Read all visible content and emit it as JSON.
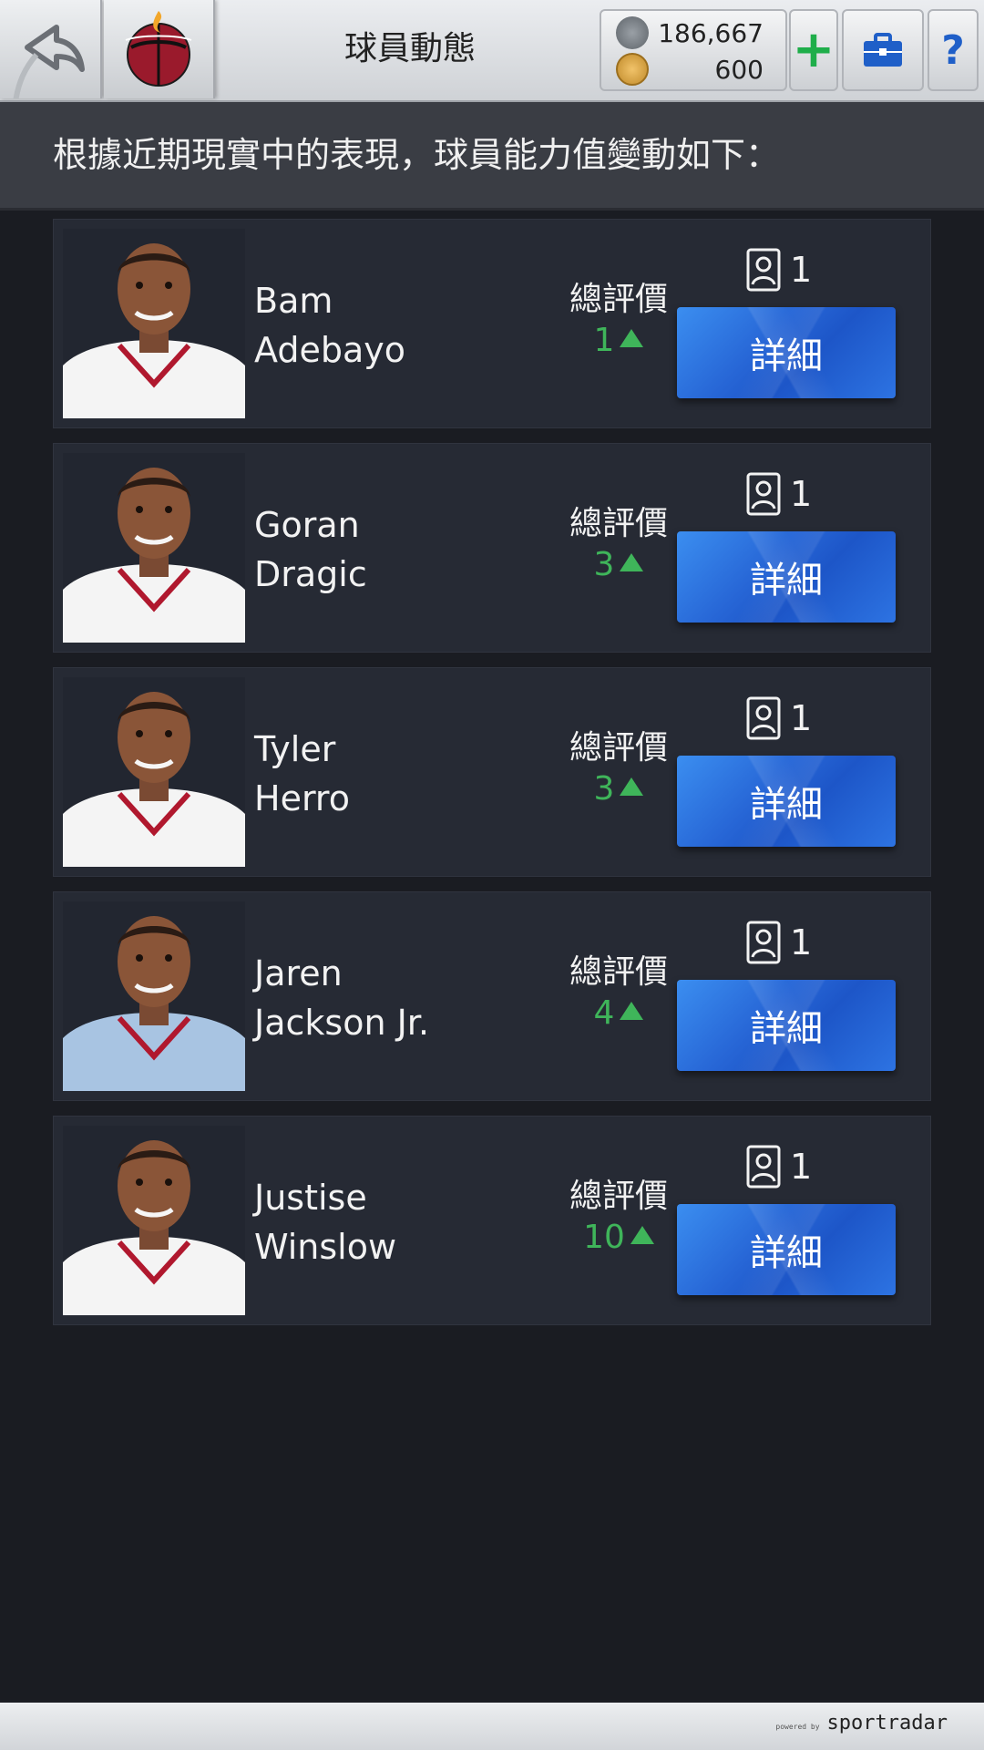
{
  "header": {
    "title": "球員動態",
    "cash": "186,667",
    "coins": "600",
    "help_label": "?"
  },
  "info_text": "根據近期現實中的表現，球員能力值變動如下：",
  "players": [
    {
      "first_name": "Bam",
      "last_name": "Adebayo",
      "rating_label": "總評價",
      "rating_change": "1",
      "count": "1",
      "detail_label": "詳細",
      "jersey": "#f4f4f4"
    },
    {
      "first_name": "Goran",
      "last_name": "Dragic",
      "rating_label": "總評價",
      "rating_change": "3",
      "count": "1",
      "detail_label": "詳細",
      "jersey": "#f4f4f4"
    },
    {
      "first_name": "Tyler",
      "last_name": "Herro",
      "rating_label": "總評價",
      "rating_change": "3",
      "count": "1",
      "detail_label": "詳細",
      "jersey": "#f4f4f4"
    },
    {
      "first_name": "Jaren",
      "last_name": "Jackson Jr.",
      "rating_label": "總評價",
      "rating_change": "4",
      "count": "1",
      "detail_label": "詳細",
      "jersey": "#a8c4e2"
    },
    {
      "first_name": "Justise",
      "last_name": "Winslow",
      "rating_label": "總評價",
      "rating_change": "10",
      "count": "1",
      "detail_label": "詳細",
      "jersey": "#f4f4f4"
    }
  ],
  "footer": {
    "small_label": "powered by",
    "brand": "sportradar"
  },
  "colors": {
    "accent_green": "#3fb55a",
    "button_blue": "#2766d6",
    "card_bg": "#262a34"
  }
}
